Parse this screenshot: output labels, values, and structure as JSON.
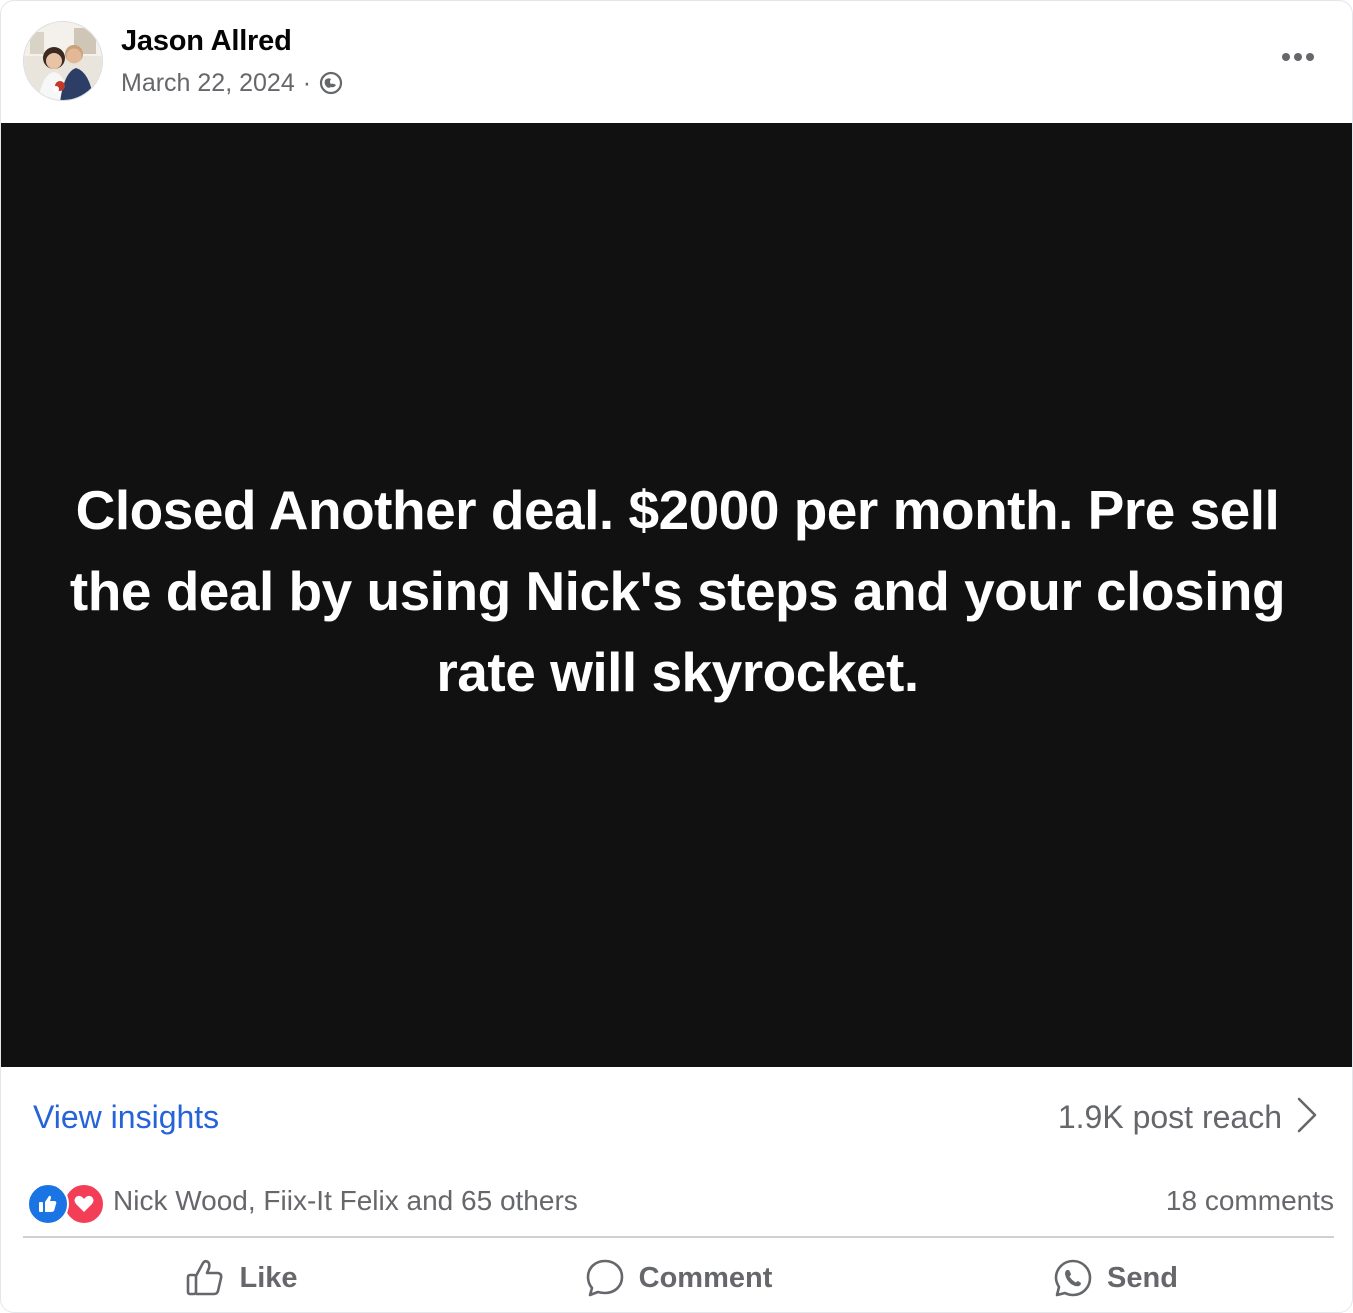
{
  "post": {
    "author": "Jason Allred",
    "date": "March 22, 2024",
    "separator": "·",
    "audience_icon": "globe-icon",
    "more_icon": "ellipsis-icon",
    "text": "Closed Another deal. $2000 per month. Pre sell the deal by using Nick's steps and your closing rate will skyrocket.",
    "background_color": "#111111",
    "text_color": "#ffffff"
  },
  "insights": {
    "link_label": "View insights",
    "reach_label": "1.9K post reach",
    "chevron_icon": "chevron-right-icon",
    "link_color": "#2563d9"
  },
  "engagement": {
    "reaction_icons": [
      "like-reaction-icon",
      "love-reaction-icon"
    ],
    "reactors": "Nick Wood, Fiix-It Felix and 65 others",
    "comments": "18 comments"
  },
  "actions": {
    "like_label": "Like",
    "comment_label": "Comment",
    "send_label": "Send"
  }
}
